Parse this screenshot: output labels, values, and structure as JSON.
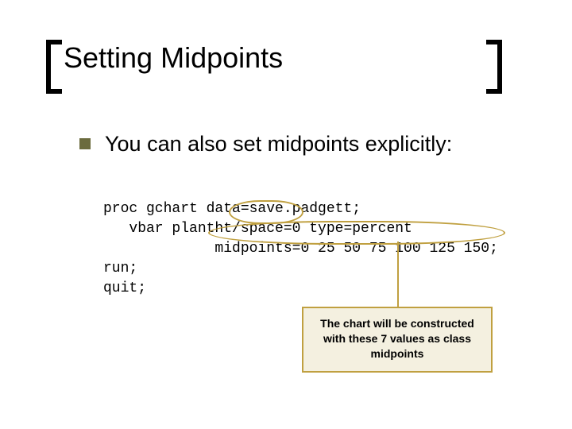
{
  "title": "Setting Midpoints",
  "bullet": "You can also set midpoints explicitly:",
  "code": {
    "l1": "proc gchart data=save.padgett;",
    "l2": "   vbar plantht/space=0 type=percent",
    "l3": "             midpoints=0 25 50 75 100 125 150;",
    "l4": "run;",
    "l5": "quit;"
  },
  "callout": "The chart will be constructed with these 7 values as class midpoints"
}
